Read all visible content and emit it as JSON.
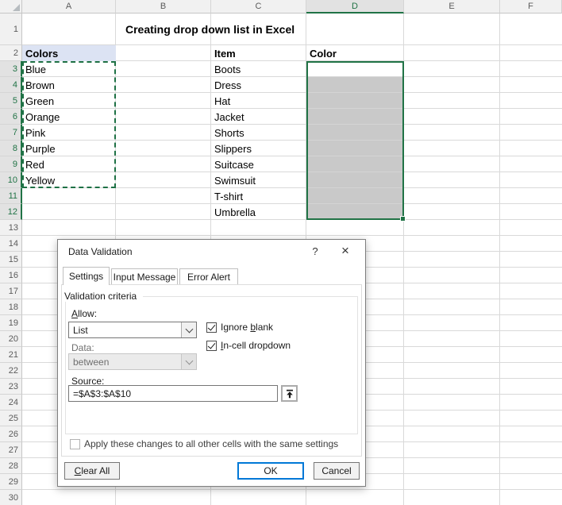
{
  "grid": {
    "title": "Creating drop down list in Excel",
    "column_letters": [
      "A",
      "B",
      "C",
      "D",
      "E",
      "F"
    ],
    "selected_column": "D",
    "row_numbers": [
      "1",
      "2",
      "3",
      "4",
      "5",
      "6",
      "7",
      "8",
      "9",
      "10",
      "11",
      "12",
      "13",
      "14",
      "15",
      "16",
      "17",
      "18",
      "19",
      "20",
      "21",
      "22",
      "23",
      "24",
      "25",
      "26",
      "27",
      "28",
      "29",
      "30"
    ],
    "selected_rows_start": 3,
    "selected_rows_end": 12,
    "cells": {
      "A2": "Colors",
      "colors_list": [
        "Blue",
        "Brown",
        "Green",
        "Orange",
        "Pink",
        "Purple",
        "Red",
        "Yellow"
      ],
      "C2": "Item",
      "items_list": [
        "Boots",
        "Dress",
        "Hat",
        "Jacket",
        "Shorts",
        "Slippers",
        "Suitcase",
        "Swimsuit",
        "T-shirt",
        "Umbrella"
      ],
      "D2": "Color"
    },
    "selected_range": "D3:D12",
    "marquee_range": "A3:A10"
  },
  "dialog": {
    "title": "Data Validation",
    "help_glyph": "?",
    "close_glyph": "×",
    "tabs": [
      "Settings",
      "Input Message",
      "Error Alert"
    ],
    "active_tab": "Settings",
    "group_label": "Validation criteria",
    "allow": {
      "pre": "",
      "accel": "A",
      "post": "llow:"
    },
    "allow_value": "List",
    "ignore_blank": {
      "pre": "Ignore ",
      "accel": "b",
      "post": "lank",
      "checked": true
    },
    "incell_dropdown": {
      "pre": "",
      "accel": "I",
      "post": "n-cell dropdown",
      "checked": true
    },
    "data_label": "Data:",
    "data_value": "between",
    "source": {
      "pre": "",
      "accel": "S",
      "post": "ource:"
    },
    "source_value": "=$A$3:$A$10",
    "apply_label": "Apply these changes to all other cells with the same settings",
    "clear_button": {
      "pre": "",
      "accel": "C",
      "post": "lear All"
    },
    "ok_label": "OK",
    "cancel_label": "Cancel"
  },
  "colors": {
    "accent_green": "#217346",
    "selection_fill": "#C9C9C9",
    "colors_header_fill": "#DCE3F3",
    "focus_blue": "#0078D7",
    "gridline": "#D9D9D9"
  }
}
